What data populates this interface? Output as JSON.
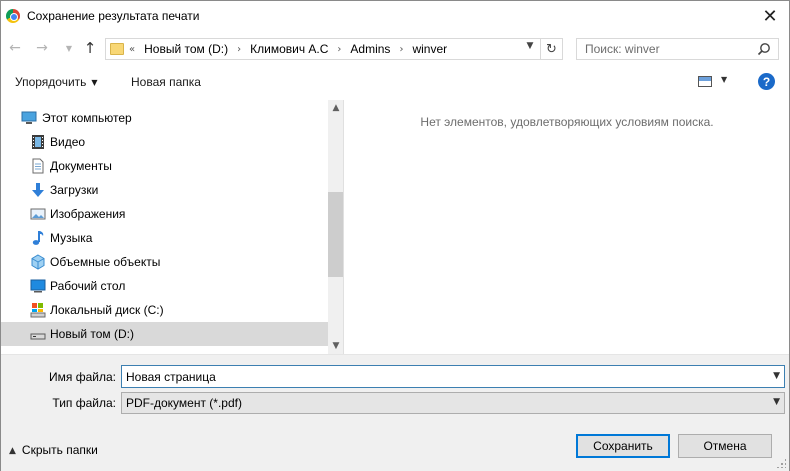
{
  "window": {
    "title": "Сохранение результата печати",
    "close_glyph": "✕"
  },
  "address": {
    "overflow": "«",
    "crumbs": [
      "Новый том (D:)",
      "Климович А.С",
      "Admins",
      "winver"
    ],
    "separator": "›"
  },
  "search": {
    "placeholder": "Поиск: winver"
  },
  "toolbar": {
    "organize_label": "Упорядочить",
    "new_folder_label": "Новая папка",
    "help_label": "?"
  },
  "navpane": {
    "items": [
      {
        "label": "Этот компьютер",
        "icon": "computer-icon"
      },
      {
        "label": "Видео",
        "icon": "video-icon"
      },
      {
        "label": "Документы",
        "icon": "documents-icon"
      },
      {
        "label": "Загрузки",
        "icon": "downloads-icon"
      },
      {
        "label": "Изображения",
        "icon": "pictures-icon"
      },
      {
        "label": "Музыка",
        "icon": "music-icon"
      },
      {
        "label": "Объемные объекты",
        "icon": "3d-objects-icon"
      },
      {
        "label": "Рабочий стол",
        "icon": "desktop-icon"
      },
      {
        "label": "Локальный диск (C:)",
        "icon": "local-disk-icon"
      },
      {
        "label": "Новый том (D:)",
        "icon": "drive-icon",
        "selected": true
      }
    ]
  },
  "content": {
    "empty_message": "Нет элементов, удовлетворяющих условиям поиска."
  },
  "form": {
    "filename_label": "Имя файла:",
    "filename_value": "Новая страница",
    "filetype_label": "Тип файла:",
    "filetype_value": "PDF-документ (*.pdf)"
  },
  "footer": {
    "hide_folders_label": "Скрыть папки",
    "save_label": "Сохранить",
    "cancel_label": "Отмена"
  },
  "colors": {
    "accent": "#0078d7",
    "selection": "#d9d9d9",
    "panel": "#f0f0f0",
    "help": "#1b6ac9"
  }
}
